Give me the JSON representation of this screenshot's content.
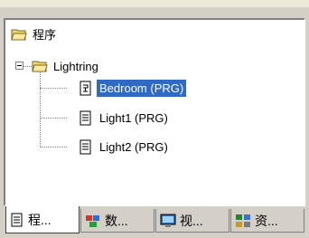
{
  "tree": {
    "root": {
      "label": "程序",
      "icon": "folder-open-icon"
    },
    "folder": {
      "label": "Lightring",
      "icon": "folder-open-icon"
    },
    "items": [
      {
        "label": "Bedroom (PRG)",
        "icon": "program-document-icon",
        "selected": true
      },
      {
        "label": "Light1 (PRG)",
        "icon": "document-icon",
        "selected": false
      },
      {
        "label": "Light2 (PRG)",
        "icon": "document-icon",
        "selected": false
      }
    ]
  },
  "tabs": [
    {
      "label": "程...",
      "icon": "document-icon",
      "active": true
    },
    {
      "label": "数...",
      "icon": "datatypes-icon",
      "active": false
    },
    {
      "label": "视...",
      "icon": "visualization-icon",
      "active": false
    },
    {
      "label": "资...",
      "icon": "resources-icon",
      "active": false
    }
  ],
  "colors": {
    "selection": "#316ac5",
    "folder": "#f2d86a",
    "background": "#d4d0c8"
  }
}
